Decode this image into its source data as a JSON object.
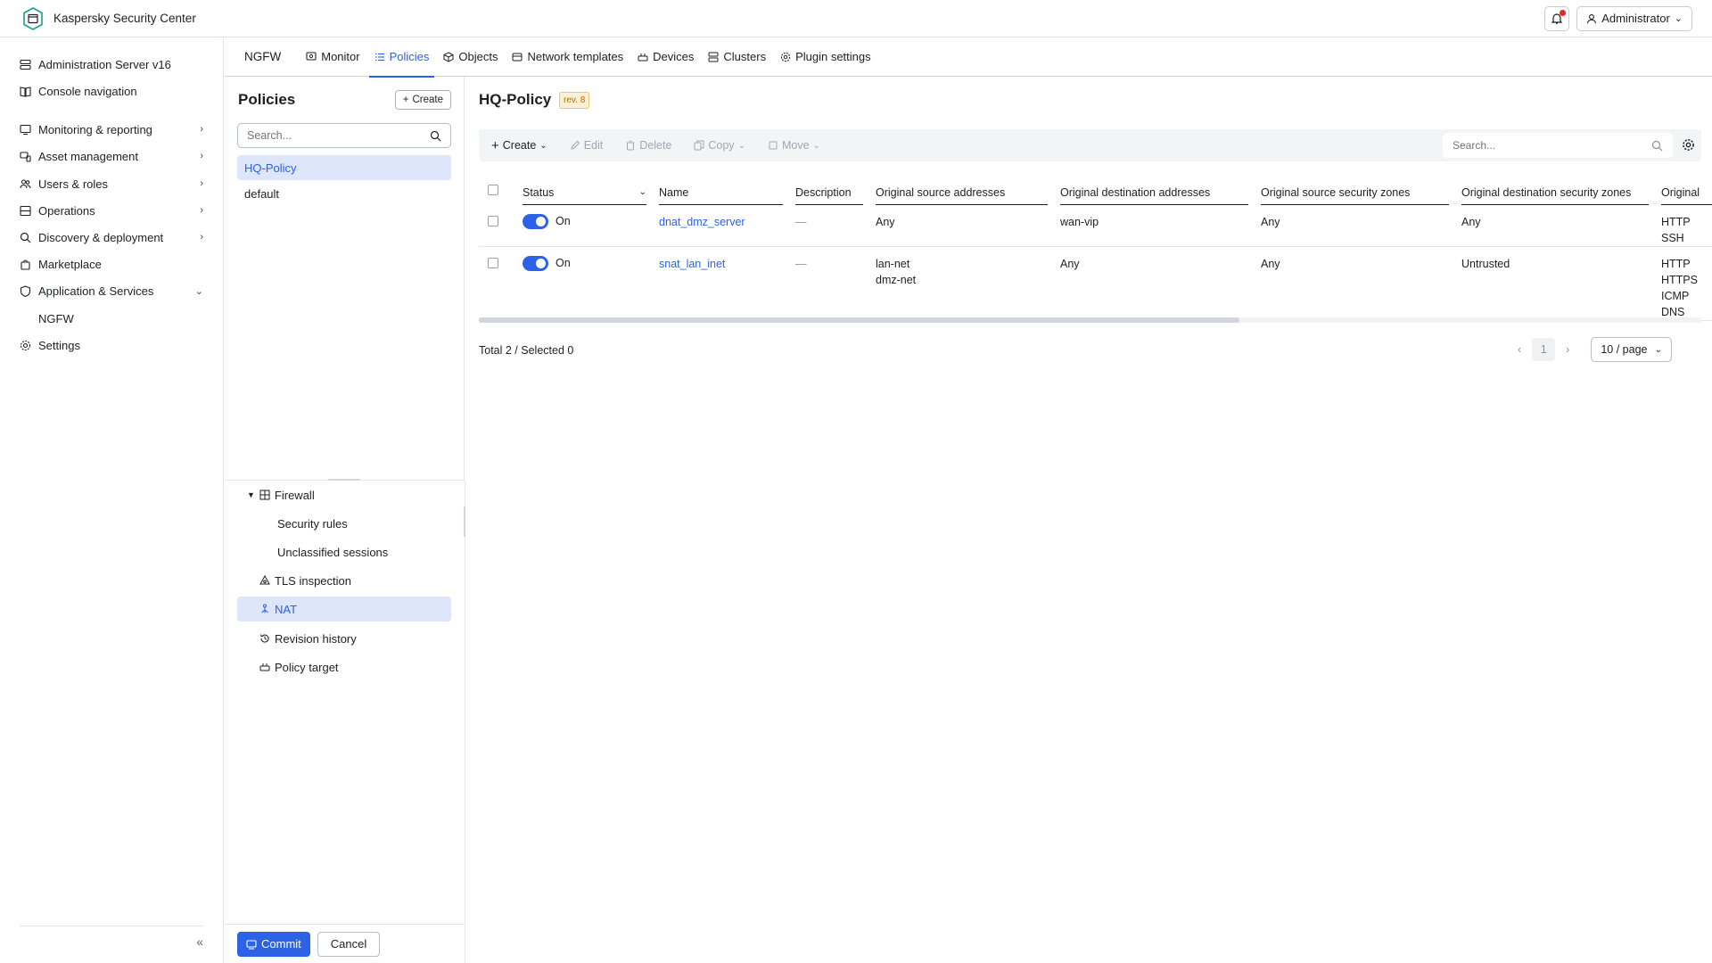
{
  "app": {
    "title": "Kaspersky Security Center",
    "user": "Administrator"
  },
  "nav": {
    "items": [
      {
        "label": "Administration Server v16",
        "icon": "server-icon",
        "chevron": ""
      },
      {
        "label": "Console navigation",
        "icon": "book-icon",
        "chevron": ""
      },
      {
        "label": "Monitoring & reporting",
        "icon": "monitor-icon",
        "chevron": "›"
      },
      {
        "label": "Asset management",
        "icon": "devices-icon",
        "chevron": "›"
      },
      {
        "label": "Users & roles",
        "icon": "users-icon",
        "chevron": "›"
      },
      {
        "label": "Operations",
        "icon": "operations-icon",
        "chevron": "›"
      },
      {
        "label": "Discovery & deployment",
        "icon": "search-icon",
        "chevron": "›"
      },
      {
        "label": "Marketplace",
        "icon": "bag-icon",
        "chevron": ""
      },
      {
        "label": "Application & Services",
        "icon": "shield-icon",
        "chevron": "⌄"
      },
      {
        "label": "NGFW",
        "icon": "",
        "chevron": ""
      },
      {
        "label": "Settings",
        "icon": "gear-icon",
        "chevron": ""
      }
    ]
  },
  "module": {
    "title": "NGFW",
    "tabs": [
      {
        "label": "Monitor",
        "icon": "gauge-icon"
      },
      {
        "label": "Policies",
        "icon": "list-icon"
      },
      {
        "label": "Objects",
        "icon": "cube-icon"
      },
      {
        "label": "Network templates",
        "icon": "template-icon"
      },
      {
        "label": "Devices",
        "icon": "device-icon"
      },
      {
        "label": "Clusters",
        "icon": "cluster-icon"
      },
      {
        "label": "Plugin settings",
        "icon": "gear-icon"
      }
    ],
    "active_tab": "Policies"
  },
  "policies": {
    "title": "Policies",
    "create_label": "Create",
    "search_placeholder": "Search...",
    "items": [
      "HQ-Policy",
      "default"
    ],
    "selected": "HQ-Policy"
  },
  "tree": {
    "items": [
      {
        "label": "Firewall"
      },
      {
        "label": "Security rules"
      },
      {
        "label": "Unclassified sessions"
      },
      {
        "label": "TLS inspection"
      },
      {
        "label": "NAT"
      },
      {
        "label": "Revision history"
      },
      {
        "label": "Policy target"
      }
    ],
    "selected": "NAT"
  },
  "footer": {
    "commit_label": "Commit",
    "cancel_label": "Cancel"
  },
  "main": {
    "title": "HQ-Policy",
    "revision": "rev. 8",
    "toolbar": {
      "create": "Create",
      "edit": "Edit",
      "delete": "Delete",
      "copy": "Copy",
      "move": "Move",
      "search_placeholder": "Search..."
    },
    "table": {
      "columns": [
        "Status",
        "Name",
        "Description",
        "Original source addresses",
        "Original destination addresses",
        "Original source security zones",
        "Original destination security zones",
        "Original"
      ],
      "rows": [
        {
          "status": "On",
          "name": "dnat_dmz_server",
          "description": "—",
          "src_addresses": "Any",
          "dst_addresses": "wan-vip",
          "src_zones": "Any",
          "dst_zones": "Any",
          "services": [
            "HTTP",
            "SSH"
          ]
        },
        {
          "status": "On",
          "name": "snat_lan_inet",
          "description": "—",
          "src_addresses": "lan-net\ndmz-net",
          "dst_addresses": "Any",
          "src_zones": "Any",
          "dst_zones": "Untrusted",
          "services": [
            "HTTP",
            "HTTPS",
            "ICMP",
            "DNS"
          ]
        }
      ]
    },
    "summary": "Total 2 / Selected 0",
    "pagination": {
      "current_page": "1",
      "page_size": "10 / page"
    }
  },
  "colors": {
    "accent": "#2c62e6",
    "selected_bg": "#dde6fb",
    "badge_bg": "#fdf0d5",
    "badge_text": "#b56a00"
  }
}
